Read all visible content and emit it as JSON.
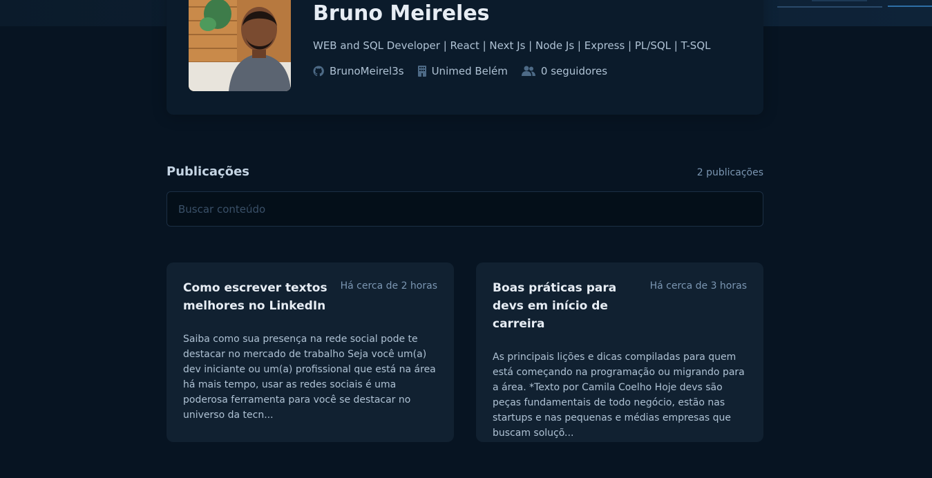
{
  "profile": {
    "name": "Bruno Meireles",
    "bio": "WEB and SQL Developer | React | Next Js | Node Js | Express | PL/SQL | T-SQL",
    "github": "BrunoMeirel3s",
    "company": "Unimed Belém",
    "followers": "0 seguidores"
  },
  "publications": {
    "title": "Publicações",
    "count": "2 publicações",
    "search_placeholder": "Buscar conteúdo",
    "posts": [
      {
        "title": "Como escrever textos melhores no LinkedIn",
        "time": "Há cerca de 2 horas",
        "excerpt": "Saiba como sua presença na rede social pode te destacar no mercado de trabalho Seja você um(a) dev iniciante ou um(a) profissional que está na área há mais tempo, usar as redes sociais é uma poderosa ferramenta para você se destacar no universo da tecn..."
      },
      {
        "title": "Boas práticas para devs em início de carreira",
        "time": "Há cerca de 3 horas",
        "excerpt": "As principais lições e dicas compiladas para quem está começando na programação ou migrando para a área. *Texto por Camila Coelho Hoje devs são peças fundamentais de todo negócio, estão nas startups e nas pequenas e médias empresas que buscam soluçõ..."
      }
    ]
  },
  "colors": {
    "background": "#071422",
    "card": "#112131",
    "profile_card": "#0B1B2B",
    "text_primary": "#E7EDF4",
    "text_secondary": "#AFC2D4",
    "text_muted": "#7B96B2"
  },
  "icons": [
    "github-icon",
    "building-icon",
    "users-icon"
  ]
}
